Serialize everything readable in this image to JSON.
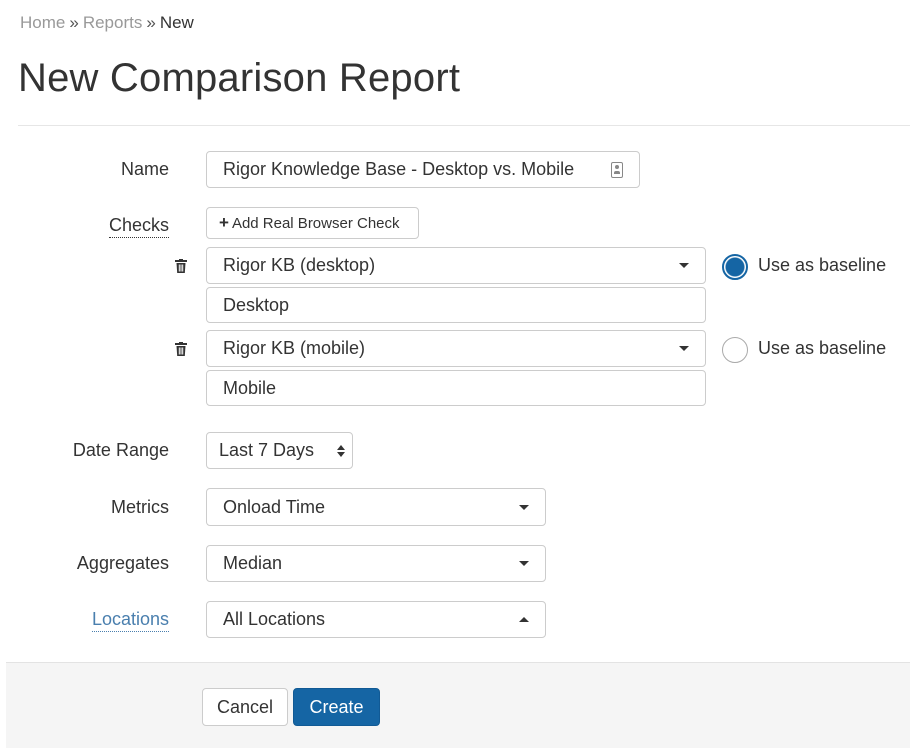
{
  "breadcrumb": {
    "items": [
      "Home",
      "Reports"
    ],
    "separator": "»",
    "current": "New"
  },
  "page": {
    "title": "New Comparison Report"
  },
  "form": {
    "name": {
      "label": "Name",
      "value": "Rigor Knowledge Base - Desktop vs. Mobile",
      "icon": "contact-card-icon"
    },
    "checks": {
      "label": "Checks",
      "add_button_label": "Add Real Browser Check",
      "add_button_icon": "+",
      "items": [
        {
          "selected": "Rigor KB (desktop)",
          "alias": "Desktop",
          "baseline_label": "Use as baseline",
          "baseline_checked": true
        },
        {
          "selected": "Rigor KB (mobile)",
          "alias": "Mobile",
          "baseline_label": "Use as baseline",
          "baseline_checked": false
        }
      ]
    },
    "date_range": {
      "label": "Date Range",
      "value": "Last 7 Days"
    },
    "metrics": {
      "label": "Metrics",
      "value": "Onload Time"
    },
    "aggregates": {
      "label": "Aggregates",
      "value": "Median"
    },
    "locations": {
      "label": "Locations",
      "value": "All Locations"
    }
  },
  "footer": {
    "cancel_label": "Cancel",
    "create_label": "Create"
  },
  "colors": {
    "primary": "#1565a4",
    "link": "#4a7fae",
    "footer_bg": "#f5f5f5"
  }
}
